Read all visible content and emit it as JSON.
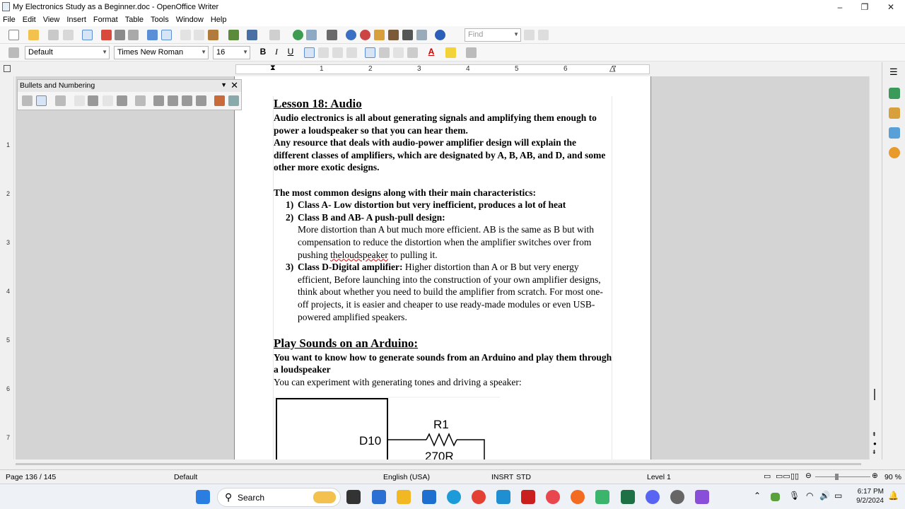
{
  "window": {
    "title": "My Electronics Study as a Beginner.doc - OpenOffice Writer",
    "minimize": "–",
    "maximize": "❐",
    "close": "✕"
  },
  "menu": [
    "File",
    "Edit",
    "View",
    "Insert",
    "Format",
    "Table",
    "Tools",
    "Window",
    "Help"
  ],
  "toolbar": {
    "find_placeholder": "Find",
    "paragraph_style": "Default",
    "font_name": "Times New Roman",
    "font_size": "16",
    "bold_label": "B",
    "italic_label": "I",
    "underline_label": "U",
    "font_color_label": "A"
  },
  "ruler": {
    "h_numbers": [
      "1",
      "2",
      "3",
      "4",
      "5",
      "6",
      "7"
    ],
    "v_numbers": [
      "1",
      "2",
      "3",
      "4",
      "5",
      "6",
      "7"
    ]
  },
  "panel": {
    "title": "Bullets and Numbering",
    "close": "✕"
  },
  "document": {
    "heading1": "Lesson 18: Audio",
    "p1": "Audio electronics is all about generating signals and amplifying them enough to power a loudspeaker so that you can hear them.",
    "p2": "Any resource that deals with audio-power amplifier design will explain the different classes of amplifiers, which are designated by A, B, AB, and D, and some other more exotic designs.",
    "p3": "The most common designs along with their main characteristics:",
    "list": [
      {
        "num": "1)",
        "bold": "Class A- Low distortion but very inefficient, produces a lot of heat",
        "text": ""
      },
      {
        "num": "2)",
        "bold": "Class B and AB- A push-pull design:",
        "text": ""
      },
      {
        "num": "3)",
        "bold": "Class D-Digital amplifier:",
        "text": " Higher distortion than A or B but very energy efficient, Before launching into the construction of your own amplifier designs, think about whether you need to build the amplifier from scratch. For most one-off projects, it is easier and cheaper to use ready-made modules or even USB-powered amplified speakers."
      }
    ],
    "item2_detail_a": "More distortion than A but much more efficient. AB is the same as B but with compensation to reduce the distortion when the amplifier switches over from pushing ",
    "item2_detail_sq": "theloudspeaker",
    "item2_detail_b": " to pulling it.",
    "heading2": "Play Sounds on an Arduino:",
    "p4": "You want to know how to generate sounds from an Arduino and play them through a loudspeaker",
    "p5": "You can experiment with generating tones and driving a speaker:",
    "circuit": {
      "pin_label": "D10",
      "resistor_label": "R1",
      "resistor_value": "270R"
    }
  },
  "status": {
    "page": "Page 136 / 145",
    "style": "Default",
    "language": "English (USA)",
    "insert_mode": "INSRT",
    "selection_mode": "STD",
    "outline_level": "Level 1",
    "zoom": "90 %"
  },
  "taskbar": {
    "search_label": "Search",
    "time": "6:17 PM",
    "date": "9/2/2024"
  }
}
